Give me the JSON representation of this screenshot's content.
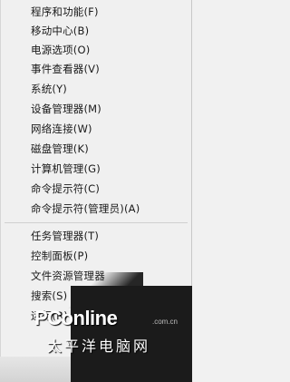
{
  "menu": {
    "items": [
      "程序和功能(F)",
      "移动中心(B)",
      "电源选项(O)",
      "事件查看器(V)",
      "系统(Y)",
      "设备管理器(M)",
      "网络连接(W)",
      "磁盘管理(K)",
      "计算机管理(G)",
      "命令提示符(C)",
      "命令提示符(管理员)(A)",
      "任务管理器(T)",
      "控制面板(P)",
      "文件资源管理器",
      "搜索(S)",
      "运行(R)"
    ]
  },
  "watermark": {
    "logo": "PConline",
    "domain": ".com.cn",
    "tagline": "太平洋电脑网"
  },
  "colors": {
    "menu_bg": "#f0f0f0",
    "text": "#1a1a1a",
    "watermark_bg": "#1b1b1b"
  }
}
